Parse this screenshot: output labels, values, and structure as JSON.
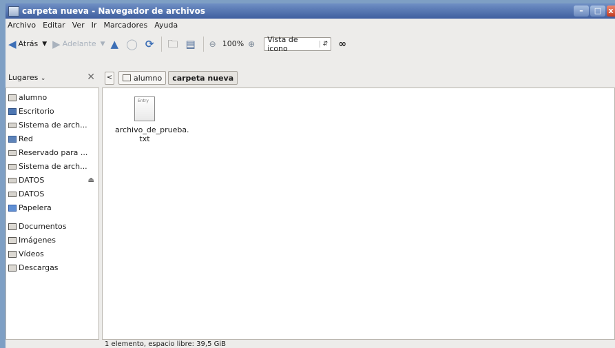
{
  "window": {
    "title": "carpeta nueva - Navegador de archivos",
    "controls": {
      "minimize": "–",
      "maximize": "□",
      "close": "x"
    }
  },
  "menubar": {
    "items": [
      "Archivo",
      "Editar",
      "Ver",
      "Ir",
      "Marcadores",
      "Ayuda"
    ]
  },
  "toolbar": {
    "back_label": "Atrás",
    "forward_label": "Adelante",
    "zoom_level": "100%",
    "view_mode": "Vista de icono"
  },
  "sidebar": {
    "header": "Lugares",
    "places": [
      {
        "label": "alumno",
        "icon": "folder-icon"
      },
      {
        "label": "Escritorio",
        "icon": "desktop-icon"
      },
      {
        "label": "Sistema de arch...",
        "icon": "drive-icon"
      },
      {
        "label": "Red",
        "icon": "network-icon"
      },
      {
        "label": "Reservado para ...",
        "icon": "drive-icon"
      },
      {
        "label": "Sistema de arch...",
        "icon": "drive-icon"
      },
      {
        "label": "DATOS",
        "icon": "drive-icon"
      },
      {
        "label": "DATOS",
        "icon": "drive-icon"
      },
      {
        "label": "Papelera",
        "icon": "trash-icon"
      }
    ],
    "bookmarks": [
      {
        "label": "Documentos",
        "icon": "folder-icon"
      },
      {
        "label": "Imágenes",
        "icon": "folder-icon"
      },
      {
        "label": "Vídeos",
        "icon": "folder-icon"
      },
      {
        "label": "Descargas",
        "icon": "folder-icon"
      }
    ]
  },
  "pathbar": {
    "crumbs": [
      "alumno",
      "carpeta nueva"
    ]
  },
  "content": {
    "files": [
      {
        "name": "archivo_de_prueba.\ntxt",
        "icon_text": "Entry"
      }
    ]
  },
  "statusbar": {
    "text": "1 elemento, espacio libre: 39,5 GiB"
  }
}
